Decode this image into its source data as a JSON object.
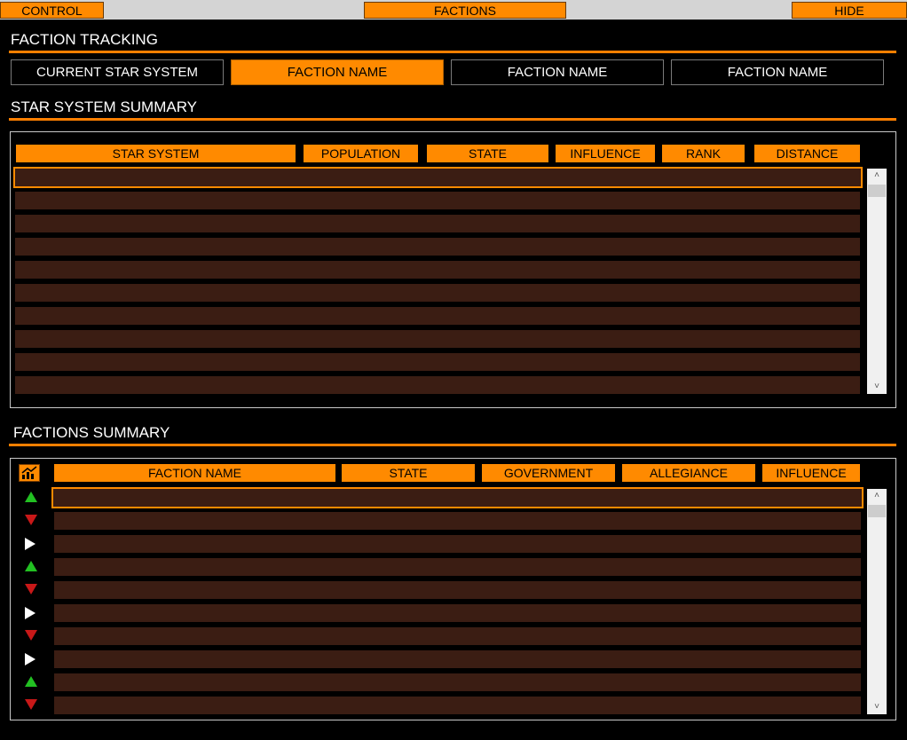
{
  "top_bar": {
    "control_label": "CONTROL",
    "factions_label": "FACTIONS",
    "hide_label": "HIDE"
  },
  "faction_tracking": {
    "title": "FACTION TRACKING",
    "buttons": [
      {
        "label": "CURRENT STAR SYSTEM",
        "active": false
      },
      {
        "label": "FACTION NAME",
        "active": true
      },
      {
        "label": "FACTION NAME",
        "active": false
      },
      {
        "label": "FACTION NAME",
        "active": false
      }
    ]
  },
  "star_system_summary": {
    "title": "STAR SYSTEM SUMMARY",
    "columns": [
      "STAR SYSTEM",
      "POPULATION",
      "STATE",
      "INFLUENCE",
      "RANK",
      "DISTANCE"
    ],
    "row_count": 10,
    "selected_row": 0
  },
  "factions_summary": {
    "title": "FACTIONS SUMMARY",
    "trend_icon": "chart-trend-icon",
    "columns": [
      "FACTION NAME",
      "STATE",
      "GOVERNMENT",
      "ALLEGIANCE",
      "INFLUENCE"
    ],
    "trends": [
      "up",
      "down",
      "flat",
      "up",
      "down",
      "flat",
      "down",
      "flat",
      "up",
      "down"
    ],
    "selected_row": 0
  },
  "colors": {
    "accent": "#ff8a00",
    "row": "#3b1d13",
    "up": "#22c022",
    "down": "#c81818",
    "flat": "#ffffff"
  }
}
